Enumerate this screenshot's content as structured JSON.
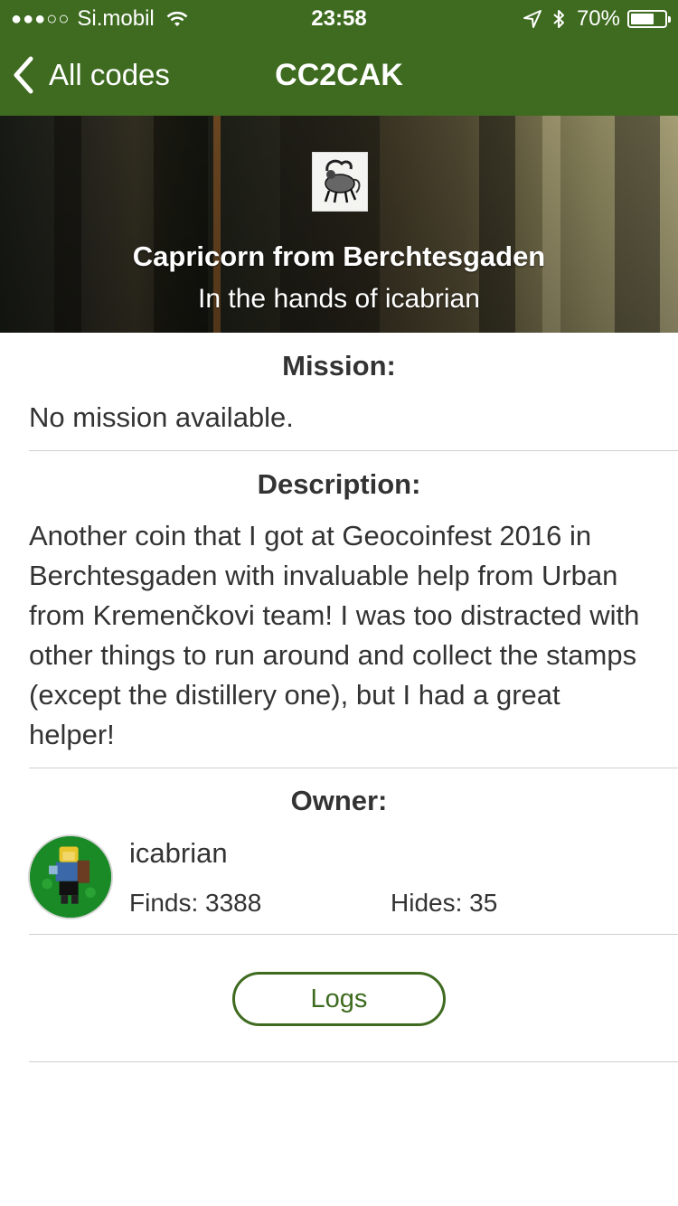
{
  "status_bar": {
    "signal_dots": "●●●○○",
    "carrier": "Si.mobil",
    "time": "23:58",
    "battery": "70%",
    "battery_level": 0.7
  },
  "nav": {
    "back_label": "All codes",
    "title": "CC2CAK"
  },
  "hero": {
    "coin_name": "Capricorn from Berchtesgaden",
    "holder": "In the hands of icabrian"
  },
  "mission": {
    "title": "Mission:",
    "text": "No mission available."
  },
  "description": {
    "title": "Description:",
    "text": "Another coin that I got at Geocoinfest 2016 in Berchtesgaden with invaluable help from Urban from Kremenčkovi team! I was too distracted with other things to run around and collect the stamps (except the distillery one), but I had a great helper!"
  },
  "owner": {
    "title": "Owner:",
    "name": "icabrian",
    "finds": "Finds: 3388",
    "hides": "Hides: 35"
  },
  "logs_button": "Logs",
  "colors": {
    "brand_green": "#3e6b1f",
    "text": "#333333",
    "divider": "#cfcfcf"
  },
  "icons": [
    "wifi-icon",
    "location-arrow-icon",
    "bluetooth-icon",
    "battery-icon",
    "chevron-left-icon",
    "capricorn-coin-image",
    "owner-avatar"
  ]
}
